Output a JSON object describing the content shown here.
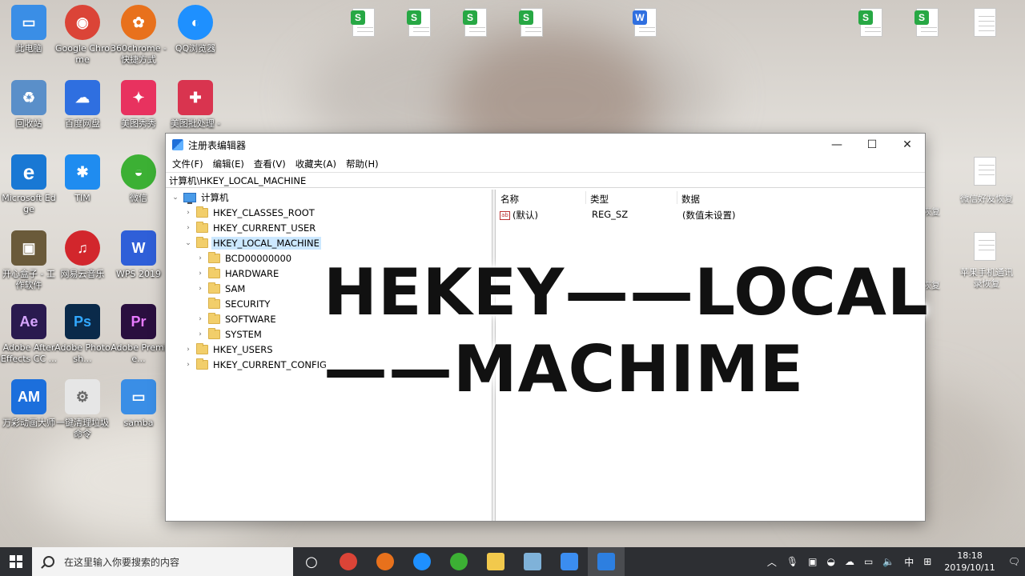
{
  "desktop": {
    "icons": [
      {
        "label": "此电脑",
        "icon": "this-pc-icon",
        "color": "#3a8ee6"
      },
      {
        "label": "Google Chrome",
        "icon": "chrome-icon",
        "color": "#db4437"
      },
      {
        "label": "360chrome - 快捷方式",
        "icon": "360-browser-icon",
        "color": "#e8711c"
      },
      {
        "label": "QQ浏览器",
        "icon": "qq-browser-icon",
        "color": "#1e90ff"
      },
      {
        "label": "回收站",
        "icon": "recycle-bin-icon",
        "color": "#5a8fc9"
      },
      {
        "label": "百度网盘",
        "icon": "baidu-netdisk-icon",
        "color": "#2f6fe0"
      },
      {
        "label": "美图秀秀",
        "icon": "meitu-icon",
        "color": "#e8325f"
      },
      {
        "label": "美图批处理 -",
        "icon": "meitu-batch-icon",
        "color": "#d9344f"
      },
      {
        "label": "Microsoft Edge",
        "icon": "edge-icon",
        "color": "#1978d4"
      },
      {
        "label": "TIM",
        "icon": "tim-icon",
        "color": "#1f8cf0"
      },
      {
        "label": "微信",
        "icon": "wechat-icon",
        "color": "#3cb034"
      },
      {
        "label": "开心盒子 - 工作软件",
        "icon": "box-app-icon",
        "color": "#6a5a3a"
      },
      {
        "label": "网易云音乐",
        "icon": "netease-music-icon",
        "color": "#d2262c"
      },
      {
        "label": "WPS 2019",
        "icon": "wps-icon",
        "color": "#2f5fd8"
      },
      {
        "label": "Adobe After Effects CC ...",
        "icon": "after-effects-icon",
        "color": "#2a1a4f"
      },
      {
        "label": "Adobe Photosh...",
        "icon": "photoshop-icon",
        "color": "#0a2a4a"
      },
      {
        "label": "Adobe Premie...",
        "icon": "premiere-icon",
        "color": "#2a0f3f"
      },
      {
        "label": "万彩动画大师",
        "icon": "animation-master-icon",
        "color": "#1c6fdc"
      },
      {
        "label": "一键清理垃圾命令",
        "icon": "cleanup-script-icon",
        "color": "#b8b8b8"
      },
      {
        "label": "samba",
        "icon": "samba-icon",
        "color": "#3a8ee6"
      }
    ],
    "glyphs": {
      "this_pc": "▭",
      "chrome": "◉",
      "q360": "✿",
      "qq": "◐",
      "bin": "♻",
      "baidu": "☁",
      "meitu": "✦",
      "meitu_batch": "✚",
      "edge": "e",
      "tim": "✱",
      "wechat": "◒",
      "box": "▣",
      "netease": "♫",
      "wps": "W",
      "ae": "Ae",
      "ps": "Ps",
      "pr": "Pr",
      "am": "AM",
      "cleanup": "⚙",
      "samba": "▭"
    },
    "right_labels": [
      "恢复",
      "恢复",
      "微信好友恢复",
      "恢复",
      "苹果手机通讯录恢复"
    ]
  },
  "window": {
    "title": "注册表编辑器",
    "min_glyph": "—",
    "max_glyph": "☐",
    "close_glyph": "✕",
    "menu": [
      "文件(F)",
      "编辑(E)",
      "查看(V)",
      "收藏夹(A)",
      "帮助(H)"
    ],
    "address": "计算机\\HKEY_LOCAL_MACHINE",
    "tree": {
      "root": "计算机",
      "expanded_arrow": "⌄",
      "collapsed_arrow": "›",
      "nodes": [
        {
          "label": "HKEY_CLASSES_ROOT"
        },
        {
          "label": "HKEY_CURRENT_USER"
        },
        {
          "label": "HKEY_LOCAL_MACHINE"
        },
        {
          "label": "BCD00000000"
        },
        {
          "label": "HARDWARE"
        },
        {
          "label": "SAM"
        },
        {
          "label": "SECURITY"
        },
        {
          "label": "SOFTWARE"
        },
        {
          "label": "SYSTEM"
        },
        {
          "label": "HKEY_USERS"
        },
        {
          "label": "HKEY_CURRENT_CONFIG"
        }
      ]
    },
    "list": {
      "columns": [
        "名称",
        "类型",
        "数据"
      ],
      "rows": [
        {
          "icon_text": "ab",
          "name": "(默认)",
          "type": "REG_SZ",
          "data": "(数值未设置)"
        }
      ]
    }
  },
  "overlay_text": "HEKEY——LOCAL\n——MACHIME",
  "taskbar": {
    "search_placeholder": "在这里输入你要搜索的内容",
    "task_view_glyph": "○",
    "apps": [
      {
        "icon": "chrome-taskbar-icon",
        "color": "#db4437"
      },
      {
        "icon": "360-taskbar-icon",
        "color": "#e8711c"
      },
      {
        "icon": "qq-browser-taskbar-icon",
        "color": "#1e90ff"
      },
      {
        "icon": "wechat-taskbar-icon",
        "color": "#3cb034"
      },
      {
        "icon": "file-explorer-taskbar-icon",
        "color": "#f2c94c"
      },
      {
        "icon": "notepad-taskbar-icon",
        "color": "#7fb2d9"
      },
      {
        "icon": "feishu-taskbar-icon",
        "color": "#3b8df0"
      },
      {
        "icon": "regedit-taskbar-icon",
        "color": "#2d7fe0"
      }
    ],
    "tray": {
      "chevron": "︿",
      "mic": "🎙",
      "camera": "▣",
      "wechat": "◒",
      "network": "☁",
      "monitor": "▭",
      "volume": "🔈",
      "ime": "中",
      "ime_grid": "⊞",
      "notification": "🗨",
      "time": "18:18",
      "date": "2019/10/11"
    }
  }
}
